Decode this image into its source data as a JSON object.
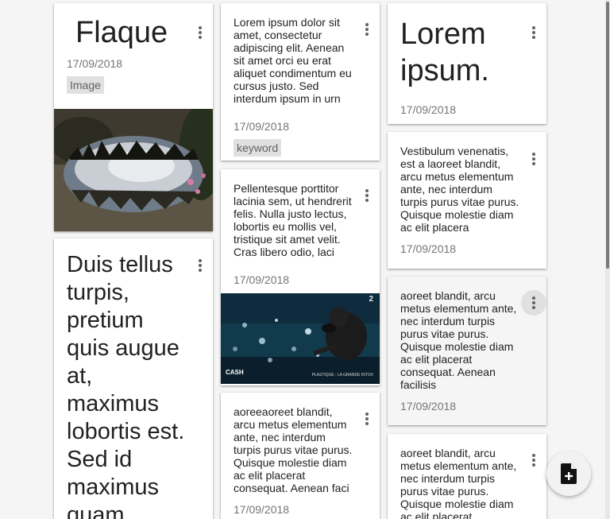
{
  "notes": [
    {
      "title": "Flaque",
      "date": "17/09/2018",
      "tag": "Image"
    },
    {
      "text": "Duis tellus turpis, pretium quis augue at, maximus lobortis est. Sed id maximus quam."
    },
    {
      "text": "Lorem ipsum dolor sit amet, consectetur adipiscing elit. Aenean sit amet orci eu erat aliquet condimentum eu cursus justo. Sed interdum ipsum in urn",
      "date": "17/09/2018",
      "tag": "keyword"
    },
    {
      "text": "Pellentesque porttitor lacinia sem, ut hendrerit felis. Nulla justo lectus, lobortis eu mollis vel, tristique sit amet velit. Cras libero odio, laci",
      "date": "17/09/2018",
      "video_caption": "PLASTIQUE : LA GRANDE INTOX",
      "video_logo": "CASH",
      "video_badge": "2"
    },
    {
      "text": "aoreeaoreet blandit, arcu metus elementum ante, nec interdum turpis purus vitae purus. Quisque molestie diam ac elit placerat consequat. Aenean faci",
      "date": "17/09/2018"
    },
    {
      "title": "Lorem ipsum.",
      "date": "17/09/2018"
    },
    {
      "text": "Vestibulum venenatis, est a laoreet blandit, arcu metus elementum ante, nec interdum turpis purus vitae purus. Quisque molestie diam ac elit placera",
      "date": "17/09/2018"
    },
    {
      "text": "aoreet blandit, arcu metus elementum ante, nec interdum turpis purus vitae purus. Quisque molestie diam ac elit placerat consequat. Aenean facilisis",
      "date": "17/09/2018"
    },
    {
      "text": "aoreet blandit, arcu metus elementum ante, nec interdum turpis purus vitae purus. Quisque molestie diam ac elit placerat"
    }
  ],
  "icons": {
    "note_menu": "more-vert-icon",
    "add_note": "note-add-icon"
  }
}
